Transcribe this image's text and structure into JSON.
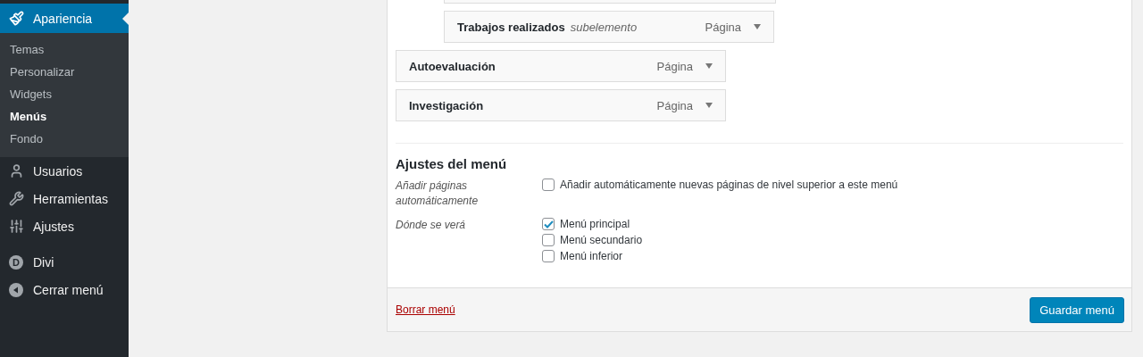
{
  "sidebar": {
    "items": [
      {
        "label": "Apariencia",
        "kind": "brush",
        "selected": true,
        "children": [
          {
            "label": "Temas",
            "selected": false
          },
          {
            "label": "Personalizar",
            "selected": false
          },
          {
            "label": "Widgets",
            "selected": false
          },
          {
            "label": "Menús",
            "selected": true
          },
          {
            "label": "Fondo",
            "selected": false
          }
        ]
      },
      {
        "label": "Usuarios",
        "kind": "user",
        "selected": false
      },
      {
        "label": "Herramientas",
        "kind": "wrench",
        "selected": false
      },
      {
        "label": "Ajustes",
        "kind": "sliders",
        "selected": false
      },
      {
        "label": "Divi",
        "kind": "divi",
        "icon_text": "D",
        "selected": false
      },
      {
        "label": "Cerrar menú",
        "kind": "collapse",
        "selected": false
      }
    ]
  },
  "menu_structure": {
    "items": [
      {
        "title": "Trabajos realizados",
        "note": "subelemento",
        "type": "Página",
        "kind": "subitem"
      },
      {
        "title": "Autoevaluación",
        "type": "Página",
        "kind": "item"
      },
      {
        "title": "Investigación",
        "type": "Página",
        "kind": "item"
      }
    ]
  },
  "menu_settings": {
    "heading": "Ajustes del menú",
    "groups": [
      {
        "label": "Añadir páginas automáticamente",
        "options": [
          {
            "label": "Añadir automáticamente nuevas páginas de nivel superior a este menú",
            "checked": false
          }
        ]
      },
      {
        "label": "Dónde se verá",
        "options": [
          {
            "label": "Menú principal",
            "checked": true
          },
          {
            "label": "Menú secundario",
            "checked": false
          },
          {
            "label": "Menú inferior",
            "checked": false
          }
        ]
      }
    ]
  },
  "footer": {
    "delete_link": "Borrar menú",
    "save_button": "Guardar menú"
  }
}
